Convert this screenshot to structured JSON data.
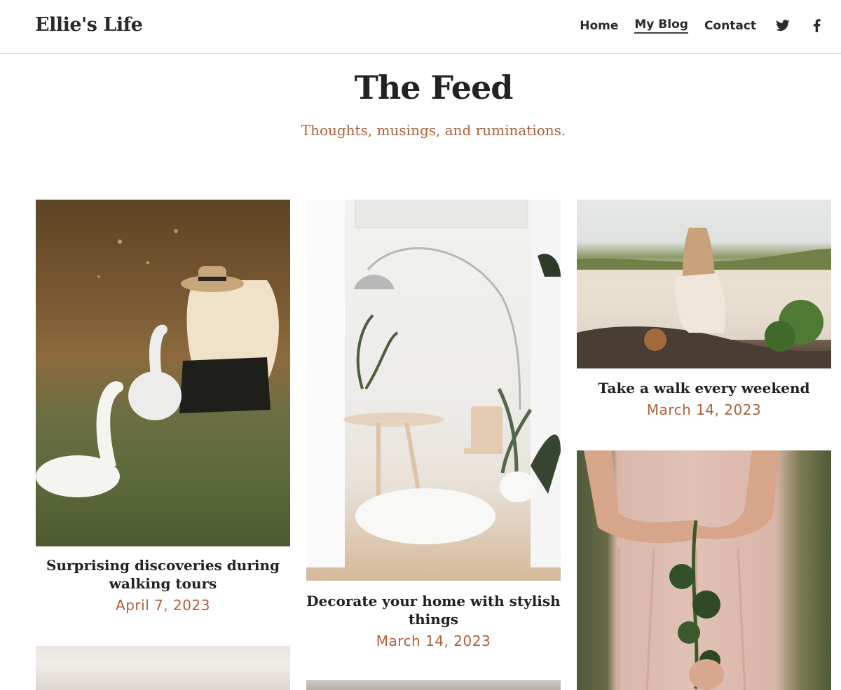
{
  "site": {
    "brand": "Ellie's Life"
  },
  "nav": {
    "items": [
      {
        "label": "Home",
        "active": false
      },
      {
        "label": "My Blog",
        "active": true
      },
      {
        "label": "Contact",
        "active": false
      }
    ],
    "social": [
      "twitter-icon",
      "facebook-icon"
    ]
  },
  "hero": {
    "title": "The Feed",
    "subtitle": "Thoughts, musings, and ruminations."
  },
  "posts": [
    {
      "title": "Surprising discoveries during walking tours",
      "date": "April 7, 2023"
    },
    {
      "title": "Decorate your home with stylish things",
      "date": "March 14, 2023"
    },
    {
      "title": "Take a walk every weekend",
      "date": "March 14, 2023"
    }
  ],
  "colors": {
    "accent": "#b0603b",
    "text": "#222222",
    "border": "#dcdcdc"
  }
}
